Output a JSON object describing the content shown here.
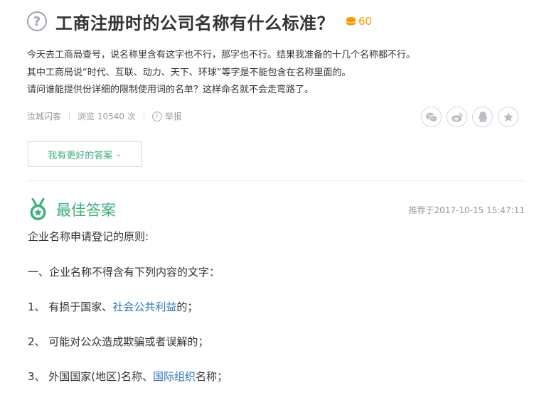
{
  "question": {
    "icon": "question-circle-icon",
    "title": "工商注册时的公司名称有什么标准？",
    "reward": "60",
    "reward_icon": "coin-stack-icon",
    "description": [
      "今天去工商局查号，说名称里含有这字也不行，那字也不行。结果我准备的十几个名称都不行。",
      "其中工商局说“时代、互联、动力、天下、环球”等字是不能包含在名称里面的。",
      "请问谁能提供份详细的限制使用词的名单？这样命名就不会走弯路了。"
    ],
    "meta": {
      "author": "汝城闪客",
      "views": "浏览 10540 次",
      "report": "举报"
    }
  },
  "share": {
    "icons": [
      "wechat-icon",
      "weibo-icon",
      "qq-icon",
      "favorite-star-icon"
    ]
  },
  "better_answer_button": "我有更好的答案",
  "best_answer": {
    "title": "最佳答案",
    "recommended_time": "推荐于2017-10-15 15:47:11",
    "lines": {
      "l0": "企业名称申请登记的原则:",
      "l1": "一、企业名称不得含有下列内容的文字：",
      "l2_prefix": "1、 有损于国家、",
      "l2_link": "社会公共利益",
      "l2_suffix": "的；",
      "l3": "2、 可能对公众造成欺骗或者误解的；",
      "l4_prefix": "3、 外国国家(地区)名称、",
      "l4_link": "国际组织",
      "l4_suffix": "名称；"
    }
  },
  "colors": {
    "accent_green": "#3eaf7c",
    "link_blue": "#2e73b8",
    "coin_orange": "#f39800",
    "meta_gray": "#999999"
  }
}
